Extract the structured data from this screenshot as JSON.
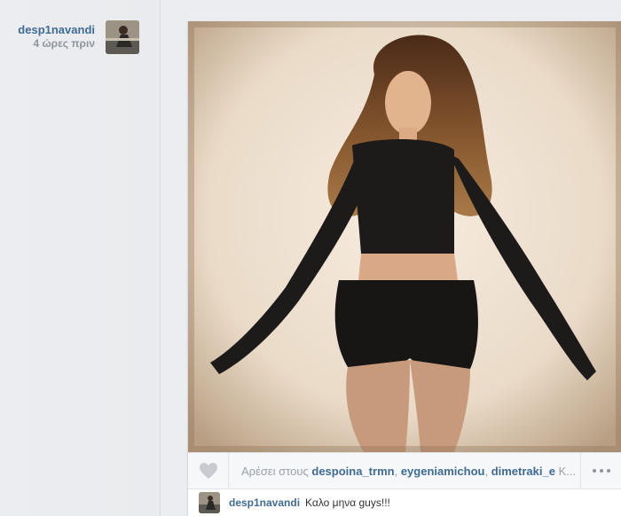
{
  "author": {
    "username": "desp1navandi",
    "time_ago": "4 ώρες πριν"
  },
  "likes": {
    "prefix": "Αρέσει στους",
    "names": [
      "despoina_trmn",
      "eygeniamichou",
      "dimetraki_e"
    ],
    "suffix": "K..."
  },
  "caption": {
    "username": "desp1navandi",
    "text": "Καλο μηνα guys!!!"
  },
  "colors": {
    "link": "#3f6b95",
    "muted": "#9aa1a7"
  },
  "icons": {
    "like": "heart-icon",
    "more": "more-options-icon"
  }
}
